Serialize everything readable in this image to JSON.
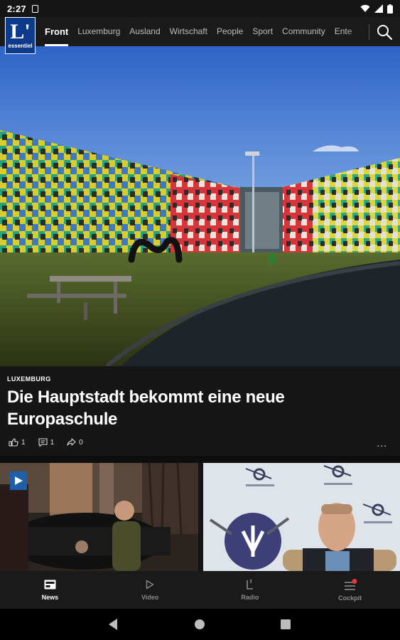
{
  "status_bar": {
    "time": "2:27"
  },
  "logo": {
    "big": "L'",
    "small": "essentiel"
  },
  "nav": {
    "tabs": [
      {
        "label": "Front",
        "active": true
      },
      {
        "label": "Luxemburg"
      },
      {
        "label": "Ausland"
      },
      {
        "label": "Wirtschaft"
      },
      {
        "label": "People"
      },
      {
        "label": "Sport"
      },
      {
        "label": "Community"
      },
      {
        "label": "Ente"
      }
    ]
  },
  "hero_article": {
    "kicker": "LUXEMBURG",
    "headline": "Die Hauptstadt bekommt eine neue Europaschule",
    "likes": "1",
    "comments": "1",
    "shares": "0",
    "more": "..."
  },
  "bottom_nav": {
    "news": "News",
    "video": "Video",
    "radio": "Radio",
    "cockpit": "Cockpit"
  },
  "colors": {
    "accent": "#ffffff",
    "logo_bg": "#0d3a8a",
    "badge": "#e53935"
  }
}
